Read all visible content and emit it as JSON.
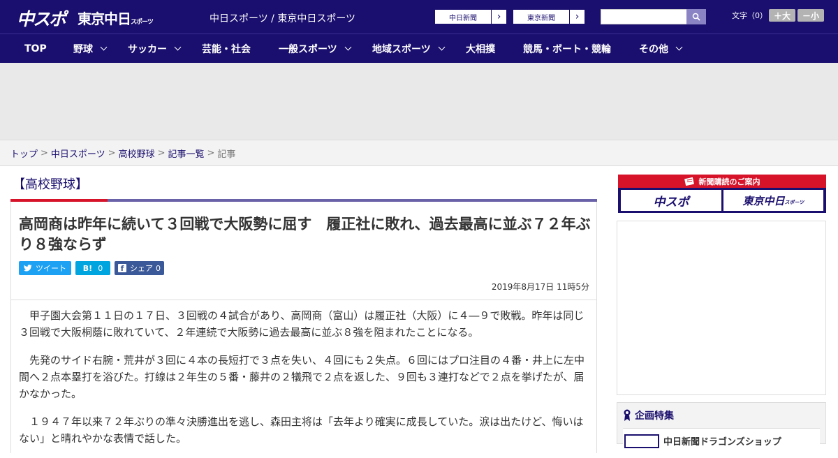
{
  "header": {
    "logo_chuspo": "中スポ",
    "logo_tokyo": "東京中日",
    "logo_tokyo_small": "スポーツ",
    "site_title": "中日スポーツ / 東京中日スポーツ",
    "site_links": [
      "中日新聞",
      "東京新聞"
    ],
    "search_placeholder": "",
    "font_size_label": "文字（0）",
    "font_larger": "＋大",
    "font_smaller": "－小"
  },
  "nav": [
    {
      "label": "TOP",
      "has_menu": false
    },
    {
      "label": "野球",
      "has_menu": true
    },
    {
      "label": "サッカー",
      "has_menu": true
    },
    {
      "label": "芸能・社会",
      "has_menu": false
    },
    {
      "label": "一般スポーツ",
      "has_menu": true
    },
    {
      "label": "地域スポーツ",
      "has_menu": true
    },
    {
      "label": "大相撲",
      "has_menu": false
    },
    {
      "label": "競馬・ボート・競輪",
      "has_menu": false
    },
    {
      "label": "その他",
      "has_menu": true
    }
  ],
  "breadcrumb": {
    "items": [
      "トップ",
      "中日スポーツ",
      "高校野球",
      "記事一覧"
    ],
    "current": "記事",
    "separator": ">"
  },
  "article": {
    "category": "【高校野球】",
    "headline": "高岡商は昨年に続いて３回戦で大阪勢に屈す　履正社に敗れ、過去最高に並ぶ７２年ぶり８強ならず",
    "share": {
      "tweet": "ツイート",
      "hatena_label": "B!",
      "hatena_count": "0",
      "facebook": "シェア",
      "facebook_count": "0"
    },
    "date": "2019年8月17日 11時5分",
    "paragraphs": [
      "甲子園大会第１１日の１７日、３回戦の４試合があり、高岡商（富山）は履正社（大阪）に４―９で敗戦。昨年は同じ３回戦で大阪桐蔭に敗れていて、２年連続で大阪勢に過去最高に並ぶ８強を阻まれたことになる。",
      "先発のサイド右腕・荒井が３回に４本の長短打で３点を失い、４回にも２失点。６回にはプロ注目の４番・井上に左中間へ２点本塁打を浴びた。打線は２年生の５番・藤井の２犠飛で２点を返した、９回も３連打などで２点を挙げたが、届かなかった。",
      "１９４７年以来７２年ぶりの準々決勝進出を逃し、森田主将は「去年より確実に成長していた。涙は出たけど、悔いはない」と晴れやかな表情で話した。"
    ]
  },
  "sidebar": {
    "promo_title": "新聞購読のご案内",
    "promo_buttons": [
      "中スポ",
      "東京中日"
    ],
    "promo_button_small": "スポーツ",
    "feature_title": "企画特集",
    "feature_item": "中日新聞ドラゴンズショップ"
  },
  "colors": {
    "brand": "#1a0f6e",
    "accent_red": "#d7132a",
    "twitter": "#1da1f2",
    "hatena": "#00a4de",
    "facebook": "#3b5998"
  }
}
